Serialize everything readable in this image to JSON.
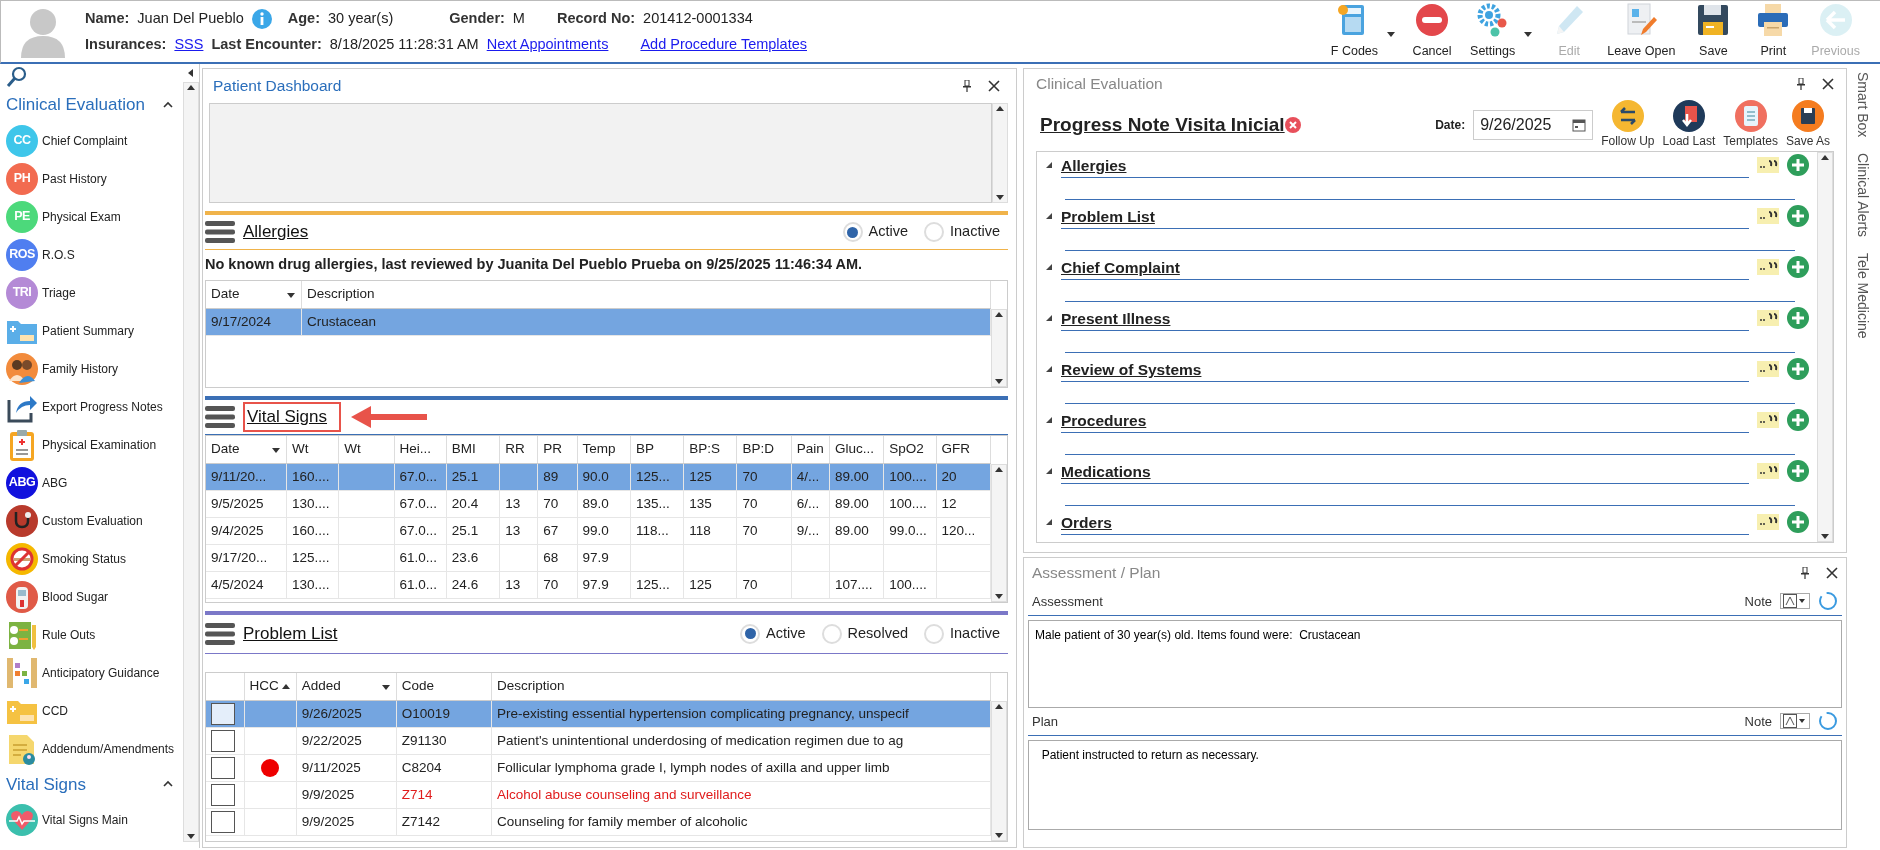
{
  "header": {
    "name_label": "Name:",
    "name": "Juan Del Pueblo",
    "age_label": "Age:",
    "age": "30 year(s)",
    "gender_label": "Gender:",
    "gender": "M",
    "record_label": "Record No:",
    "record": "201412-0001334",
    "insurances_label": "Insurances:",
    "insurance": "SSS",
    "last_encounter_label": "Last Encounter:",
    "last_encounter": "8/18/2025 11:28:31 AM",
    "links": [
      "Next Appointments",
      "Add Procedure Templates"
    ]
  },
  "toolbar": [
    {
      "kind": "fcodes",
      "label": "F Codes",
      "dropdown": true,
      "disabled": false
    },
    {
      "kind": "cancel",
      "label": "Cancel",
      "dropdown": false,
      "disabled": false
    },
    {
      "kind": "settings",
      "label": "Settings",
      "dropdown": true,
      "disabled": false
    },
    {
      "kind": "edit",
      "label": "Edit",
      "dropdown": false,
      "disabled": true
    },
    {
      "kind": "leave_open",
      "label": "Leave Open",
      "dropdown": false,
      "disabled": false
    },
    {
      "kind": "save",
      "label": "Save",
      "dropdown": false,
      "disabled": false
    },
    {
      "kind": "print",
      "label": "Print",
      "dropdown": false,
      "disabled": false
    },
    {
      "kind": "previous",
      "label": "Previous",
      "dropdown": false,
      "disabled": true
    }
  ],
  "sidebar": {
    "sections": [
      {
        "title": "Clinical Evaluation",
        "expanded": true,
        "items": [
          {
            "kind": "badge",
            "badge": "CC",
            "label": "Chief Complaint",
            "color": "#3ec6ea"
          },
          {
            "kind": "badge",
            "badge": "PH",
            "label": "Past History",
            "color": "#f26b50"
          },
          {
            "kind": "badge",
            "badge": "PE",
            "label": "Physical Exam",
            "color": "#4cd97b"
          },
          {
            "kind": "badge",
            "badge": "ROS",
            "label": "R.O.S",
            "color": "#4f7ef0"
          },
          {
            "kind": "badge",
            "badge": "TRI",
            "label": "Triage",
            "color": "#b48ad6"
          },
          {
            "kind": "folder",
            "label": "Patient Summary",
            "color": "#5aaee8"
          },
          {
            "kind": "family",
            "label": "Family History",
            "color": "#f28b3c"
          },
          {
            "kind": "export",
            "label": "Export Progress Notes",
            "color": "#2d79c7"
          },
          {
            "kind": "clipboard",
            "label": "Physical Examination",
            "color": "#f5a623"
          },
          {
            "kind": "badge",
            "badge": "ABG",
            "label": "ABG",
            "color": "#1111dd"
          },
          {
            "kind": "stethoscope",
            "label": "Custom Evaluation",
            "color": "#b83a2c"
          },
          {
            "kind": "smoking",
            "label": "Smoking Status",
            "color": "#f5b800"
          },
          {
            "kind": "meter",
            "label": "Blood Sugar",
            "color": "#e05a47"
          },
          {
            "kind": "checklist",
            "label": "Rule Outs",
            "color": "#7cb342"
          },
          {
            "kind": "abacus",
            "label": "Anticipatory Guidance",
            "color": "#e0b870"
          },
          {
            "kind": "folder",
            "label": "CCD",
            "color": "#f5c242"
          },
          {
            "kind": "note",
            "label": "Addendum/Amendments",
            "color": "#f5d76e"
          }
        ]
      },
      {
        "title": "Vital Signs",
        "expanded": true,
        "items": [
          {
            "kind": "heart",
            "label": "Vital Signs Main",
            "color": "#3bbfad"
          }
        ]
      }
    ]
  },
  "dashboard": {
    "title": "Patient Dashboard"
  },
  "allergies": {
    "title": "Allergies",
    "filters": [
      {
        "label": "Active",
        "selected": true
      },
      {
        "label": "Inactive",
        "selected": false
      }
    ],
    "summary": "No known drug allergies, last reviewed by Juanita Del Pueblo Prueba on 9/25/2025 11:46:34 AM.",
    "columns": [
      {
        "label": "Date",
        "sorted": true,
        "ascending": false
      },
      {
        "label": "Description",
        "sorted": false
      }
    ],
    "rows": [
      {
        "cells": [
          "9/17/2024",
          "Crustacean"
        ],
        "selected": true
      }
    ]
  },
  "vital_signs": {
    "title": "Vital Signs",
    "highlighted": true,
    "columns": [
      {
        "label": "Date",
        "sorted": true,
        "ascending": false
      },
      {
        "label": "Wt",
        "sorted": false
      },
      {
        "label": "Wt",
        "sorted": false
      },
      {
        "label": "Hei...",
        "sorted": false
      },
      {
        "label": "BMI",
        "sorted": false
      },
      {
        "label": "RR",
        "sorted": false
      },
      {
        "label": "PR",
        "sorted": false
      },
      {
        "label": "Temp",
        "sorted": false
      },
      {
        "label": "BP",
        "sorted": false
      },
      {
        "label": "BP:S",
        "sorted": false
      },
      {
        "label": "BP:D",
        "sorted": false
      },
      {
        "label": "Pain",
        "sorted": false
      },
      {
        "label": "Gluc...",
        "sorted": false
      },
      {
        "label": "SpO2",
        "sorted": false
      },
      {
        "label": "GFR",
        "sorted": false
      }
    ],
    "rows": [
      {
        "cells": [
          "9/11/20...",
          "160....",
          "",
          "67.0...",
          "25.1",
          "",
          "89",
          "90.0",
          "125...",
          "125",
          "70",
          "4/...",
          "89.00",
          "100....",
          "20"
        ],
        "selected": true
      },
      {
        "cells": [
          "9/5/2025",
          "130....",
          "",
          "67.0...",
          "20.4",
          "13",
          "70",
          "89.0",
          "135...",
          "135",
          "70",
          "6/...",
          "89.00",
          "100....",
          "12"
        ],
        "selected": false
      },
      {
        "cells": [
          "9/4/2025",
          "160....",
          "",
          "67.0...",
          "25.1",
          "13",
          "67",
          "99.0",
          "118...",
          "118",
          "70",
          "9/...",
          "89.00",
          "99.0...",
          "120..."
        ],
        "selected": false
      },
      {
        "cells": [
          "9/17/20...",
          "125....",
          "",
          "61.0...",
          "23.6",
          "",
          "68",
          "97.9",
          "",
          "",
          "",
          "",
          "",
          "",
          ""
        ],
        "selected": false
      },
      {
        "cells": [
          "4/5/2024",
          "130....",
          "",
          "61.0...",
          "24.6",
          "13",
          "70",
          "97.9",
          "125...",
          "125",
          "70",
          "",
          "107....",
          "100....",
          ""
        ],
        "selected": false
      }
    ]
  },
  "problem_list": {
    "title": "Problem List",
    "filters": [
      {
        "label": "Active",
        "selected": true
      },
      {
        "label": "Resolved",
        "selected": false
      },
      {
        "label": "Inactive",
        "selected": false
      }
    ],
    "columns": [
      {
        "label": "HCC",
        "sorted": true,
        "ascending": true
      },
      {
        "label": "Added",
        "sorted": true,
        "ascending": false
      },
      {
        "label": "Code",
        "sorted": false
      },
      {
        "label": "Description",
        "sorted": false
      }
    ],
    "rows": [
      {
        "checked": false,
        "hcc": false,
        "added": "9/26/2025",
        "code": "O10019",
        "description": "Pre-existing essential hypertension complicating pregnancy, unspecif",
        "flagged": false,
        "selected": true
      },
      {
        "checked": false,
        "hcc": false,
        "added": "9/22/2025",
        "code": "Z91130",
        "description": "Patient's unintentional underdosing of medication regimen due to ag",
        "flagged": false,
        "selected": false
      },
      {
        "checked": false,
        "hcc": true,
        "added": "9/11/2025",
        "code": "C8204",
        "description": "Follicular lymphoma grade I, lymph nodes of axilla and upper limb",
        "flagged": false,
        "selected": false
      },
      {
        "checked": false,
        "hcc": false,
        "added": "9/9/2025",
        "code": "Z714",
        "description": "Alcohol abuse counseling and surveillance",
        "flagged": true,
        "selected": false
      },
      {
        "checked": false,
        "hcc": false,
        "added": "9/9/2025",
        "code": "Z7142",
        "description": "Counseling for family member of alcoholic",
        "flagged": false,
        "selected": false
      }
    ]
  },
  "clinical_evaluation": {
    "panel_title": "Clinical Evaluation",
    "note_title": "Progress Note Visita Inicial",
    "date_label": "Date:",
    "date": "9/26/2025",
    "actions": [
      {
        "kind": "follow_up",
        "label": "Follow Up"
      },
      {
        "kind": "load_last",
        "label": "Load Last"
      },
      {
        "kind": "templates",
        "label": "Templates"
      },
      {
        "kind": "save_as",
        "label": "Save As"
      }
    ],
    "sections": [
      {
        "title": "Allergies",
        "expanded": true
      },
      {
        "title": "Problem List",
        "expanded": true
      },
      {
        "title": "Chief Complaint",
        "expanded": true
      },
      {
        "title": "Present Illness",
        "expanded": true
      },
      {
        "title": "Review of Systems",
        "expanded": true
      },
      {
        "title": "Procedures",
        "expanded": true
      },
      {
        "title": "Medications",
        "expanded": true
      },
      {
        "title": "Orders",
        "expanded": true
      }
    ]
  },
  "assessment_plan": {
    "panel_title": "Assessment / Plan",
    "fields": [
      {
        "label": "Assessment",
        "note_label": "Note",
        "text": "Male patient of 30 year(s) old. Items found were:  Crustacean"
      },
      {
        "label": "Plan",
        "note_label": "Note",
        "text": "  Patient instructed to return as necessary."
      }
    ]
  },
  "side_tabs": [
    "Smart Box",
    "Clinical Alerts",
    "Tele Medicine"
  ]
}
